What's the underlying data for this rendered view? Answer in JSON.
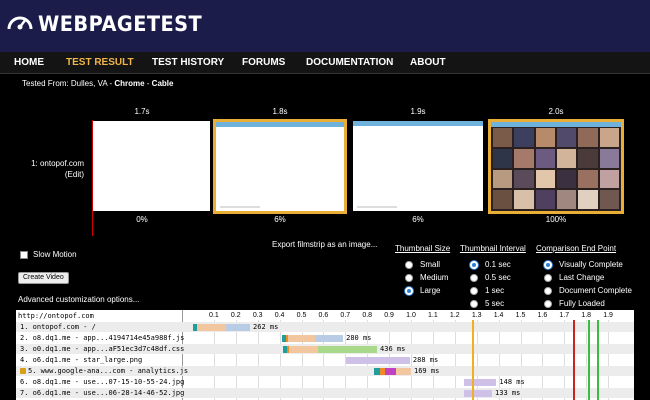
{
  "brand": {
    "logo_text": "WEBPAGETEST"
  },
  "nav": [
    {
      "label": "HOME",
      "active": false
    },
    {
      "label": "TEST RESULT",
      "active": true
    },
    {
      "label": "TEST HISTORY",
      "active": false
    },
    {
      "label": "FORUMS",
      "active": false
    },
    {
      "label": "DOCUMENTATION",
      "active": false
    },
    {
      "label": "ABOUT",
      "active": false
    }
  ],
  "tested_from": {
    "prefix": "Tested From: Dulles, VA - ",
    "browser": "Chrome",
    "sep": " - ",
    "connection": "Cable"
  },
  "filmstrip": {
    "site": "1: ontopof.com",
    "edit": "(Edit)",
    "frames": [
      {
        "time": "1.7s",
        "complete": "0%",
        "changed": false,
        "content": "blank"
      },
      {
        "time": "1.8s",
        "complete": "6%",
        "changed": true,
        "content": "header"
      },
      {
        "time": "1.9s",
        "complete": "6%",
        "changed": false,
        "content": "header"
      },
      {
        "time": "2.0s",
        "complete": "100%",
        "changed": true,
        "content": "photos"
      }
    ],
    "export_link": "Export filmstrip as an image..."
  },
  "controls": {
    "slow_motion": "Slow Motion",
    "create_video": "Create Video",
    "advanced": "Advanced customization options..."
  },
  "options": {
    "thumbnail_size": {
      "title": "Thumbnail Size",
      "items": [
        {
          "label": "Small",
          "selected": false
        },
        {
          "label": "Medium",
          "selected": false
        },
        {
          "label": "Large",
          "selected": true
        }
      ]
    },
    "thumbnail_interval": {
      "title": "Thumbnail Interval",
      "items": [
        {
          "label": "0.1 sec",
          "selected": true
        },
        {
          "label": "0.5 sec",
          "selected": false
        },
        {
          "label": "1 sec",
          "selected": false
        },
        {
          "label": "5 sec",
          "selected": false
        }
      ]
    },
    "comparison_end": {
      "title": "Comparison End Point",
      "items": [
        {
          "label": "Visually Complete",
          "selected": true
        },
        {
          "label": "Last Change",
          "selected": false
        },
        {
          "label": "Document Complete",
          "selected": false
        },
        {
          "label": "Fully Loaded",
          "selected": false
        }
      ]
    }
  },
  "waterfall": {
    "url": "http://ontopof.com",
    "ticks": [
      "0.1",
      "0.2",
      "0.3",
      "0.4",
      "0.5",
      "0.6",
      "0.7",
      "0.8",
      "0.9",
      "1.0",
      "1.1",
      "1.2",
      "1.3",
      "1.4",
      "1.5",
      "1.6",
      "1.7",
      "1.8",
      "1.9"
    ],
    "rows": [
      {
        "label": "1. ontopof.com - /",
        "start": 0.005,
        "segments": [
          0.02,
          0.0,
          0.13,
          0.11
        ],
        "ms": "262 ms",
        "secure": false
      },
      {
        "label": "2. o8.dq1.me - app...4194714e45a988f.js",
        "start": 0.41,
        "segments": [
          0.02,
          0.01,
          0.12,
          0.13
        ],
        "ms": "280 ms",
        "secure": false
      },
      {
        "label": "3. o0.dq1.me - app...aF51ec3d7c48df.css",
        "start": 0.415,
        "segments": [
          0.02,
          0.01,
          0.13,
          0.27
        ],
        "ms": "436 ms",
        "secure": false
      },
      {
        "label": "4. o6.dq1.me - star_large.png",
        "start": 0.705,
        "segments": [
          0.0,
          0.0,
          0.03,
          0.26
        ],
        "ms": "288 ms",
        "secure": false
      },
      {
        "label": "5. www.google-ana...com - analytics.js",
        "start": 0.83,
        "segments": [
          0.03,
          0.02,
          0.05,
          0.07
        ],
        "ms": "169 ms",
        "secure": true
      },
      {
        "label": "6. o8.dq1.me - use...07-15-10-55-24.jpg",
        "start": 1.24,
        "segments": [
          0.0,
          0.0,
          0.0,
          0.15
        ],
        "ms": "148 ms",
        "secure": false
      },
      {
        "label": "7. o6.dq1.me - use...06-28-14-46-52.jpg",
        "start": 1.24,
        "segments": [
          0.0,
          0.0,
          0.0,
          0.13
        ],
        "ms": "133 ms",
        "secure": false
      }
    ],
    "markers": [
      {
        "value": 1.28,
        "color": "#f0b020"
      },
      {
        "value": 1.74,
        "color": "#cc2222"
      },
      {
        "value": 1.81,
        "color": "#3dbb3d"
      },
      {
        "value": 1.85,
        "color": "#3dbb3d"
      }
    ]
  }
}
